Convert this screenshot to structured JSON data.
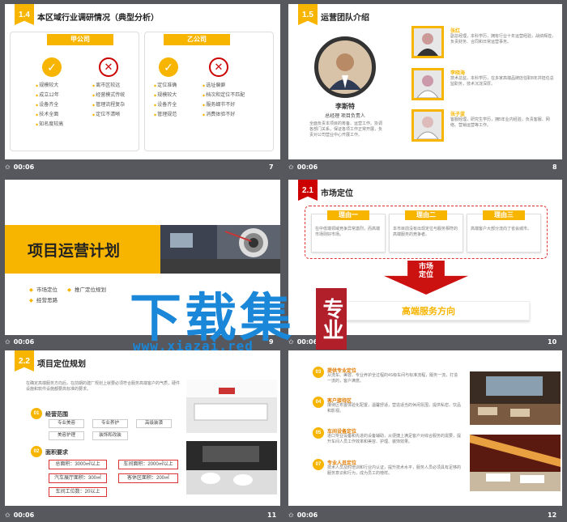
{
  "footer_time": "00:06",
  "slides": [
    {
      "number": "7",
      "badge": "1.4",
      "title": "本区域行业调研情况（典型分析）",
      "company_a": "甲公司",
      "company_b": "乙公司",
      "a_pros": [
        "规模较大",
        "成立12年",
        "设备齐全",
        "技术全面",
        "知名度较高"
      ],
      "a_cons": [
        "离市区较远",
        "经营模式传统",
        "管理流程复杂",
        "定位不清晰"
      ],
      "b_pros": [
        "定位准确",
        "规模较大",
        "设备齐全",
        "管理规范"
      ],
      "b_cons": [
        "选址偏僻",
        "档次和定位不匹配",
        "服务细节不好",
        "消费体验不好"
      ]
    },
    {
      "number": "8",
      "badge": "1.5",
      "title": "运营团队介绍",
      "leader_name": "李斯特",
      "leader_role": "总经理  项目负责人",
      "leader_desc": "全面负责本项目的筹备、运营工作。协调各部门关系，保证各项工作正常开展，负责对公司营业中心开展工作。",
      "members": [
        {
          "name": "张红",
          "desc": "副总经理，本科学历，拥有行业十年运营经验，战绩辉煌，负责财务、合同和日常运营事务。"
        },
        {
          "name": "李晓海",
          "desc": "技术总监，本科学历，在多家高端品牌店任职8年并担任总监职务，技术沉淀深厚。"
        },
        {
          "name": "张子蓝",
          "desc": "客服经理，研究生学历，拥5年业内经验，负责客服、网络、营销运营等工作。"
        }
      ]
    },
    {
      "number": "9",
      "title": "项目运营计划",
      "menu": [
        "市场定位",
        "推广定位规划",
        "经营思路"
      ]
    },
    {
      "number": "10",
      "badge": "2.1",
      "title": "市场定位",
      "reasons": [
        {
          "label": "理由一",
          "text": "在中低端领域竞争异常激烈，而高端市场则好市场。"
        },
        {
          "label": "理由二",
          "text": "本市目前没有出现定位与服务相符的高端服务的竞争者。"
        },
        {
          "label": "理由三",
          "text": "高端客户大部分流向了省会城市。"
        }
      ],
      "arrow_text": "市场\n定位",
      "result": "高端服务方向"
    },
    {
      "number": "11",
      "badge": "2.2",
      "title": "项目定位规划",
      "intro": "在确定高端服务方向后，在前期的建厂规划上就要必须符合服务高端客户的气质，硬件设施和软件设施都要高标准的要求。",
      "sec1_num": "01",
      "sec1_title": "经营范围",
      "scope": [
        "专业美容",
        "专业养护",
        "高级装潢",
        "美容护理",
        "装饰和改装"
      ],
      "sec2_num": "02",
      "sec2_title": "面积要求",
      "areas": [
        "总面积：3000㎡以上",
        "车间面积：2000㎡以上",
        "汽车展厅面积：300㎡",
        "客休区面积：200㎡",
        "车间工位数：20以上"
      ]
    },
    {
      "number": "12",
      "items": [
        {
          "num": "03",
          "title": "提供专业定位",
          "text": "从洗车、美容、专业养护全过程的4S级车间与标准流程，服务一流，打造一流的，客户满意。"
        },
        {
          "num": "04",
          "title": "客户接待区",
          "text": "接待区布置体验化配置，温馨舒适，营造适当的休闲氛围，提供私密、饮品和影视。"
        },
        {
          "num": "05",
          "title": "车间设备定位",
          "text": "进口专业设备和先进的设备辅助，从便捷上满足客户对综合服务的需要，提升车间人员工作效率和美容、护理、装饰效果。"
        },
        {
          "num": "07",
          "title": "专业人员定位",
          "text": "技术人员及时培训和行业内认证，提升技术水平，服务人员必须具有足够的服务意识和行为，成为员工的榜样。"
        }
      ]
    }
  ],
  "watermark": {
    "big": "下载集",
    "seal": "专业",
    "url": "www.xiazai.red"
  },
  "colors": {
    "accent": "#f7b500",
    "red": "#cc1111",
    "bg": "#56585e"
  }
}
